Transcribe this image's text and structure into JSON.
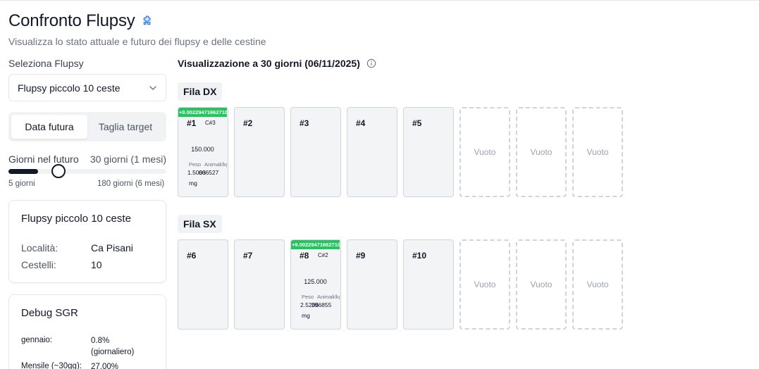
{
  "header": {
    "title": "Confronto Flupsy",
    "icon": "puzzle-icon",
    "subtitle": "Visualizza lo stato attuale e futuro dei flupsy e delle cestine"
  },
  "sidebar": {
    "select_label": "Seleziona Flupsy",
    "select_value": "Flupsy piccolo 10 ceste",
    "tabs": [
      {
        "label": "Data futura",
        "active": true
      },
      {
        "label": "Taglia target",
        "active": false
      }
    ],
    "slider": {
      "label": "Giorni nel futuro",
      "value_text": "30 giorni (1 mesi)",
      "min_label": "5 giorni",
      "max_label": "180 giorni (6 mesi)",
      "value": 30,
      "min": 5,
      "max": 180
    },
    "info_card": {
      "title": "Flupsy piccolo 10 ceste",
      "rows": [
        {
          "key": "Località:",
          "value": "Ca Pisani"
        },
        {
          "key": "Cestelli:",
          "value": "10"
        }
      ]
    },
    "debug_card": {
      "title": "Debug SGR",
      "rows": [
        {
          "key": "gennaio:",
          "value": "0.8%",
          "value2": "(giornaliero)"
        },
        {
          "key": "Mensile (~30gg):",
          "value": "27.00%"
        }
      ]
    }
  },
  "main": {
    "title": "Visualizzazione a 30 giorni (06/11/2025)",
    "rows": [
      {
        "label": "Fila DX",
        "cells": [
          {
            "num": "#1",
            "active": true,
            "badge": "+9.00229471662710",
            "code": "C#3",
            "count": "150.000",
            "peso_label": "Peso",
            "animali_label": "Animali/kg",
            "peso_value": "1.5003",
            "animali_value": "666527",
            "unit": "mg"
          },
          {
            "num": "#2"
          },
          {
            "num": "#3"
          },
          {
            "num": "#4"
          },
          {
            "num": "#5"
          },
          {
            "empty": "Vuoto"
          },
          {
            "empty": "Vuoto"
          },
          {
            "empty": "Vuoto"
          }
        ]
      },
      {
        "label": "Fila SX",
        "cells": [
          {
            "num": "#6"
          },
          {
            "num": "#7"
          },
          {
            "num": "#8",
            "active": true,
            "badge": "+9.00229471662710",
            "code": "C#2",
            "count": "125.000",
            "peso_label": "Peso",
            "animali_label": "Animali/kg",
            "peso_value": "2.5206",
            "animali_value": "396855",
            "unit": "mg"
          },
          {
            "num": "#9"
          },
          {
            "num": "#10"
          },
          {
            "empty": "Vuoto"
          },
          {
            "empty": "Vuoto"
          },
          {
            "empty": "Vuoto"
          }
        ]
      }
    ]
  },
  "colors": {
    "accent_green": "#22c55e",
    "icon_blue": "#3b82f6",
    "text_dark": "#111827"
  }
}
